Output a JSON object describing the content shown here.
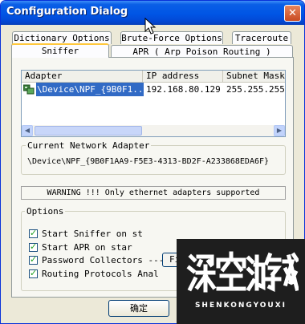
{
  "window": {
    "title": "Configuration Dialog",
    "close_glyph": "✕"
  },
  "tabs_row1": [
    "Dictionary Options",
    "Brute-Force Options",
    "Traceroute"
  ],
  "tabs_row2": [
    "Sniffer",
    "APR ( Arp Poison Routing )"
  ],
  "adapter_list": {
    "headers": [
      "Adapter",
      "IP address",
      "Subnet Mask"
    ],
    "rows": [
      {
        "adapter": "\\Device\\NPF_{9B0F1...",
        "ip": "192.168.80.129",
        "mask": "255.255.255.0"
      }
    ]
  },
  "current_adapter": {
    "label": "Current Network Adapter",
    "value": "\\Device\\NPF_{9B0F1AA9-F5E3-4313-BD2F-A233868EDA6F}"
  },
  "warning": "WARNING !!! Only ethernet adapters supported",
  "options": {
    "label": "Options",
    "items": [
      {
        "label": "Start Sniffer on st",
        "checked": true
      },
      {
        "label": "Start APR on star",
        "checked": true
      },
      {
        "label": "Password Collectors ----",
        "checked": true
      },
      {
        "label": "Routing Protocols Anal",
        "checked": true
      }
    ],
    "file_button": "Fi"
  },
  "buttons": {
    "ok": "确定"
  },
  "watermark": {
    "chars": "深空游戏",
    "sub": "SHENKONGYOUXI"
  },
  "colors": {
    "title_bar": "#0055e5",
    "selection": "#316ac5",
    "dialog_bg": "#ece9d8"
  }
}
